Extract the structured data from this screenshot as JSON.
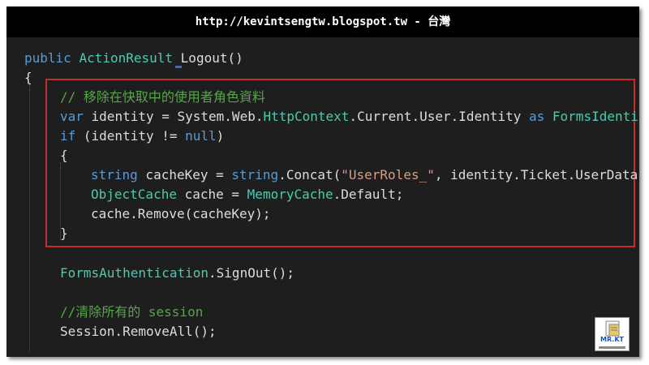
{
  "header": {
    "title": "http://kevintsengtw.blogspot.tw - 台灣"
  },
  "code": {
    "line1": {
      "kw1": "public",
      "type1": "ActionResult",
      "name": "Logout",
      "rest": "()"
    },
    "line2": {
      "text": "{"
    },
    "line3": {
      "comment": "// 移除在快取中的使用者角色資料"
    },
    "line4": {
      "kw1": "var",
      "a": " identity = System.Web.",
      "t1": "HttpContext",
      "b": ".Current.User.Identity ",
      "kw2": "as",
      "c": " ",
      "t2": "FormsIdentity",
      "d": ";"
    },
    "line5": {
      "kw1": "if",
      "a": " (identity != ",
      "kw2": "null",
      "b": ")"
    },
    "line6": {
      "text": "{"
    },
    "line7": {
      "kw1": "string",
      "a": " cacheKey = ",
      "kw2": "string",
      "b": ".Concat(",
      "str": "\"UserRoles_\"",
      "c": ", identity.Ticket.UserData);"
    },
    "line8": {
      "t1": "ObjectCache",
      "a": " cache = ",
      "t2": "MemoryCache",
      "b": ".Default;"
    },
    "line9": {
      "text": "cache.Remove(cacheKey);"
    },
    "line10": {
      "text": "}"
    },
    "line11": {
      "t1": "FormsAuthentication",
      "a": ".SignOut();"
    },
    "line12": {
      "comment": "//清除所有的 session"
    },
    "line13": {
      "text": "Session.RemoveAll();"
    }
  },
  "logo": {
    "text": "MR.KT"
  },
  "colors": {
    "keyword": "#569cd6",
    "type": "#4ec9b0",
    "string": "#d69d85",
    "comment": "#57a64a",
    "highlight_border": "#c72c2c"
  }
}
